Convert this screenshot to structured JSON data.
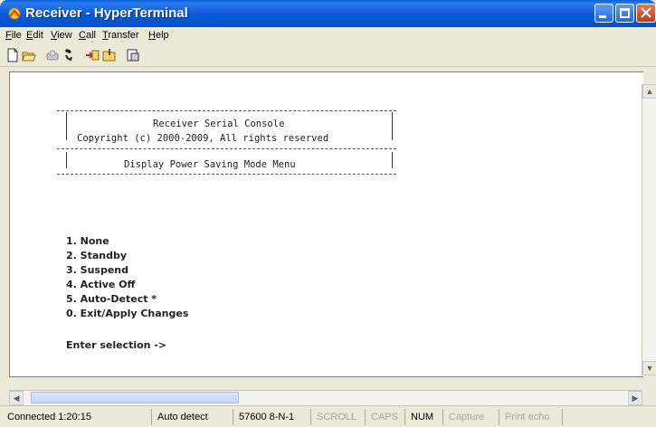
{
  "window": {
    "title": "Receiver - HyperTerminal"
  },
  "menu": [
    "File",
    "Edit",
    "View",
    "Call",
    "Transfer",
    "Help"
  ],
  "menu_underline": [
    "F",
    "E",
    "V",
    "C",
    "T",
    "H"
  ],
  "toolbar": {
    "icons": [
      "new-icon",
      "open-icon",
      "disconnect-icon",
      "dial-icon",
      "send-icon",
      "receive-icon",
      "properties-icon"
    ]
  },
  "terminal": {
    "header_title": "Receiver Serial Console",
    "header_copyright": "Copyright (c) 2000-2009, All rights reserved",
    "menu_title": "Display Power Saving Mode Menu",
    "options": [
      "1. None",
      "2. Standby",
      "3. Suspend",
      "4. Active Off",
      "5. Auto-Detect *",
      "0. Exit/Apply Changes"
    ],
    "prompt": "Enter selection ->"
  },
  "status": {
    "connected": "Connected 1:20:15",
    "detect": "Auto detect",
    "settings": "57600 8-N-1",
    "scroll": "SCROLL",
    "caps": "CAPS",
    "num": "NUM",
    "capture": "Capture",
    "print_echo": "Print echo"
  }
}
